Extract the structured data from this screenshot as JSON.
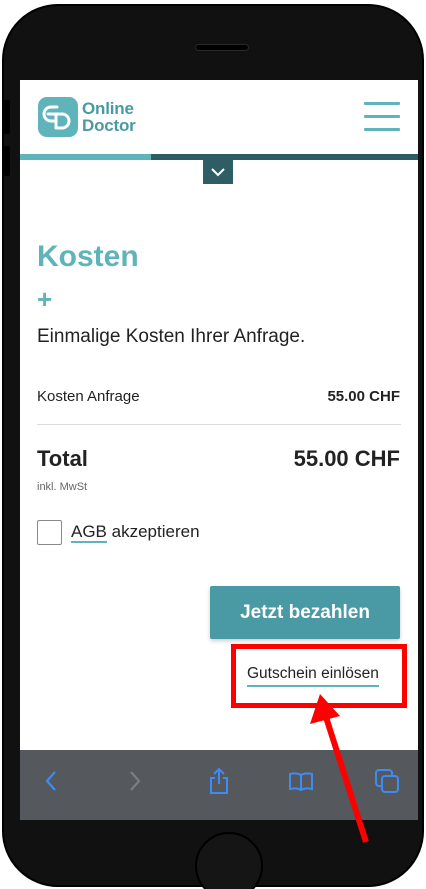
{
  "app": {
    "logo_line1": "Online",
    "logo_line2": "Doctor"
  },
  "progress": {
    "fraction": 0.33
  },
  "content": {
    "title": "Kosten",
    "plus_symbol": "+",
    "subtitle": "Einmalige Kosten Ihrer Anfrage.",
    "cost_row": {
      "label": "Kosten Anfrage",
      "value": "55.00 CHF"
    },
    "total": {
      "label": "Total",
      "value": "55.00 CHF",
      "note": "inkl. MwSt"
    },
    "terms": {
      "link": "AGB",
      "text": " akzeptieren",
      "checked": false
    },
    "pay_button": "Jetzt bezahlen",
    "voucher_link": "Gutschein einlösen"
  },
  "browser_toolbar": {
    "icons": [
      "back-icon",
      "forward-icon",
      "share-icon",
      "bookmarks-icon",
      "tabs-icon"
    ]
  },
  "colors": {
    "accent": "#5fb3bb",
    "accent_dark": "#4a9aa6",
    "progress_track": "#2f5d64",
    "annotation": "#ff0000"
  }
}
